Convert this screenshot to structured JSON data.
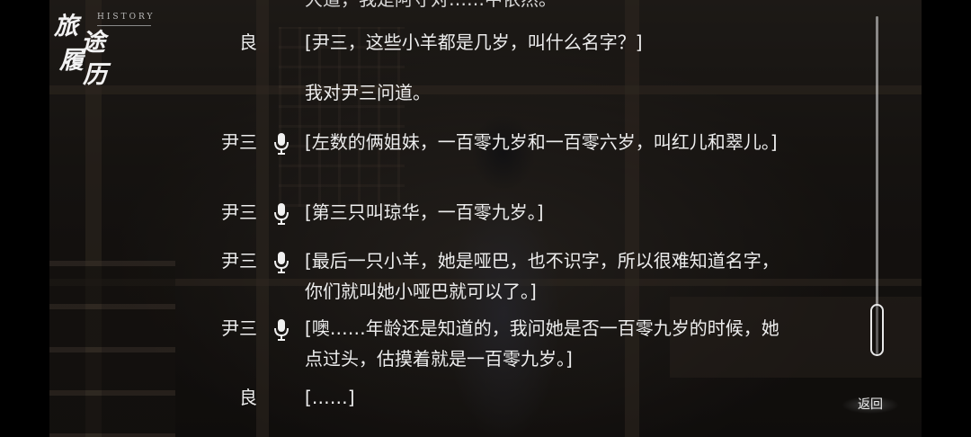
{
  "header": {
    "logo_text": "旅途履历",
    "subtitle": "HISTORY"
  },
  "log": {
    "entries": [
      {
        "speaker": "",
        "voice": false,
        "text": "大道，我是阿守对……中依然。"
      },
      {
        "speaker": "良",
        "voice": false,
        "text": "[尹三，这些小羊都是几岁，叫什么名字？]"
      },
      {
        "speaker": "",
        "voice": false,
        "text": "我对尹三问道。"
      },
      {
        "speaker": "尹三",
        "voice": true,
        "text": "[左数的俩姐妹，一百零九岁和一百零六岁，叫红儿和翠儿。]"
      },
      {
        "speaker": "尹三",
        "voice": true,
        "text": "[第三只叫琼华，一百零九岁。]"
      },
      {
        "speaker": "尹三",
        "voice": true,
        "text": "[最后一只小羊，她是哑巴，也不识字，所以很难知道名字，你们就叫她小哑巴就可以了。]"
      },
      {
        "speaker": "尹三",
        "voice": true,
        "text": "[噢……年龄还是知道的，我问她是否一百零九岁的时候，她点过头，估摸着就是一百零九岁。]"
      },
      {
        "speaker": "良",
        "voice": false,
        "text": "[……]"
      }
    ]
  },
  "scrollbar": {
    "position_fraction": 0.97
  },
  "controls": {
    "back_label": "返回"
  },
  "icons": {
    "voice": "microphone-icon"
  }
}
